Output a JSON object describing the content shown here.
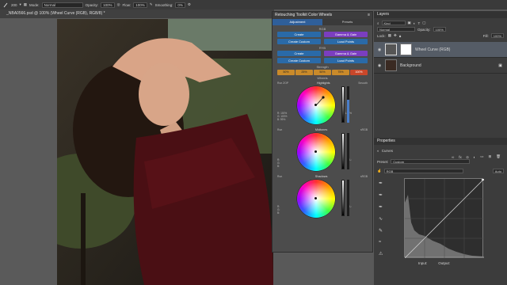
{
  "options_bar": {
    "mode_label": "Mode:",
    "mode_value": "Normal",
    "opacity_label": "Opacity:",
    "opacity_value": "100%",
    "flow_label": "Flow:",
    "flow_value": "100%",
    "smoothing_label": "Smoothing:",
    "smoothing_value": "0%",
    "brush_size": "200"
  },
  "document": {
    "tab_title": "_NBA0566.psd @ 100% (Wheel Curve (RGB), RGB/8) *"
  },
  "toolkit": {
    "title": "Retouching Toolkit Color Wheels",
    "tabs": [
      "Adjustment",
      "Presets"
    ],
    "rgb_label": "RGB",
    "rgb_buttons": [
      [
        "Create",
        "Gamma & Gain"
      ],
      [
        "Create Custom",
        "Load Points"
      ]
    ],
    "ryb_label": "RYB",
    "ryb_buttons": [
      [
        "Create",
        "Gamma & Gain"
      ],
      [
        "Create Custom",
        "Load Points"
      ]
    ],
    "strength_label": "Strength",
    "strength_values": [
      "50%",
      "25%",
      "50%",
      "75%",
      "100%"
    ],
    "wheels_label": "Wheels",
    "wheels": [
      {
        "left": "Run ZOP",
        "name": "Highlights",
        "right": "Smooth",
        "vals_left": [
          "R: 100%",
          "G: 100%",
          "B: 99%"
        ],
        "vals_right": [
          "L: 0%"
        ]
      },
      {
        "left": "Run",
        "name": "Midtones",
        "right": "sRGB",
        "vals_left": [
          "R:",
          "G:",
          "B:"
        ],
        "vals_right": [
          "L:"
        ]
      },
      {
        "left": "Run",
        "name": "Shadows",
        "right": "sRGB",
        "vals_left": [
          "R:",
          "G:",
          "B:"
        ],
        "vals_right": [
          "L:"
        ]
      }
    ]
  },
  "layers_panel": {
    "title": "Layers",
    "kind_label": "Kind",
    "blend_mode": "Normal",
    "opacity_label": "Opacity:",
    "opacity_value": "100%",
    "lock_label": "Lock:",
    "fill_label": "Fill:",
    "fill_value": "100%",
    "layers": [
      {
        "name": "Wheel Curve (RGB)",
        "selected": true
      },
      {
        "name": "Background",
        "selected": false
      }
    ]
  },
  "properties_panel": {
    "title": "Properties",
    "adj_name": "Curves",
    "preset_label": "Preset:",
    "preset_value": "Custom",
    "channel_value": "RGB",
    "auto_label": "Auto",
    "input_label": "Input:",
    "output_label": "Output:"
  },
  "colors": {
    "accent_blue": "#2a6aa8",
    "purple": "#7b3ec0",
    "strength_orange": "#c98a2a",
    "strength_red": "#c9472a"
  }
}
